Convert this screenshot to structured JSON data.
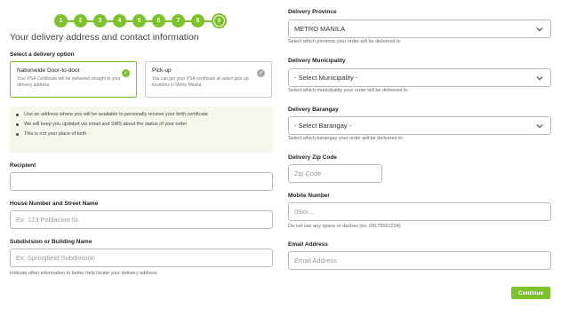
{
  "stepper": {
    "steps": [
      "1",
      "2",
      "3",
      "4",
      "5",
      "6",
      "7",
      "8",
      "9"
    ],
    "current": "9"
  },
  "heading": "Your delivery address and contact information",
  "delivery_option": {
    "label": "Select a delivery option",
    "options": [
      {
        "title": "Nationwide Door-to-door",
        "description": "Your PSA Certificate will be delivered straight to your delivery address",
        "selected": true
      },
      {
        "title": "Pick-up",
        "description": "You can get your PSA certificate at select pick up locations in Metro Manila",
        "selected": false
      }
    ]
  },
  "notice": {
    "items": [
      "Use an address where you will be available to personally receive your birth certificate",
      "We will keep you updated via email and SMS about the status of your order",
      "This is not your place of birth"
    ]
  },
  "recipient": {
    "label": "Recipient",
    "value": ""
  },
  "house": {
    "label": "House Number and Street Name",
    "placeholder": "Ex: 123 Poblacion St."
  },
  "subdivision": {
    "label": "Subdivision or Building Name",
    "placeholder": "Ex: Springfield Subdivision",
    "hint": "Indicate other information to better help locate your delivery address"
  },
  "province": {
    "label": "Delivery Province",
    "value": "METRO MANILA",
    "hint": "Select which province your order will be delivered to"
  },
  "municipality": {
    "label": "Delivery Municipality",
    "value": "- Select Municipality -",
    "hint": "Select which municipality your order will be delivered to"
  },
  "barangay": {
    "label": "Delivery Barangay",
    "value": "- Select Barangay -",
    "hint": "Select which barangay your order will be delivered to"
  },
  "zip": {
    "label": "Delivery Zip Code",
    "placeholder": "Zip Code"
  },
  "mobile": {
    "label": "Mobile Number",
    "placeholder": "09xx...",
    "hint": "Do not use any space or dashes (ex. 09175551234)"
  },
  "email": {
    "label": "Email Address",
    "placeholder": "Email Address"
  },
  "continue_label": "Continue",
  "colors": {
    "accent": "#7cc22b",
    "notice_bg": "#f3f8ea"
  },
  "icons": {
    "check": "check-circle-icon",
    "dropdown": "chevron-down-icon"
  }
}
